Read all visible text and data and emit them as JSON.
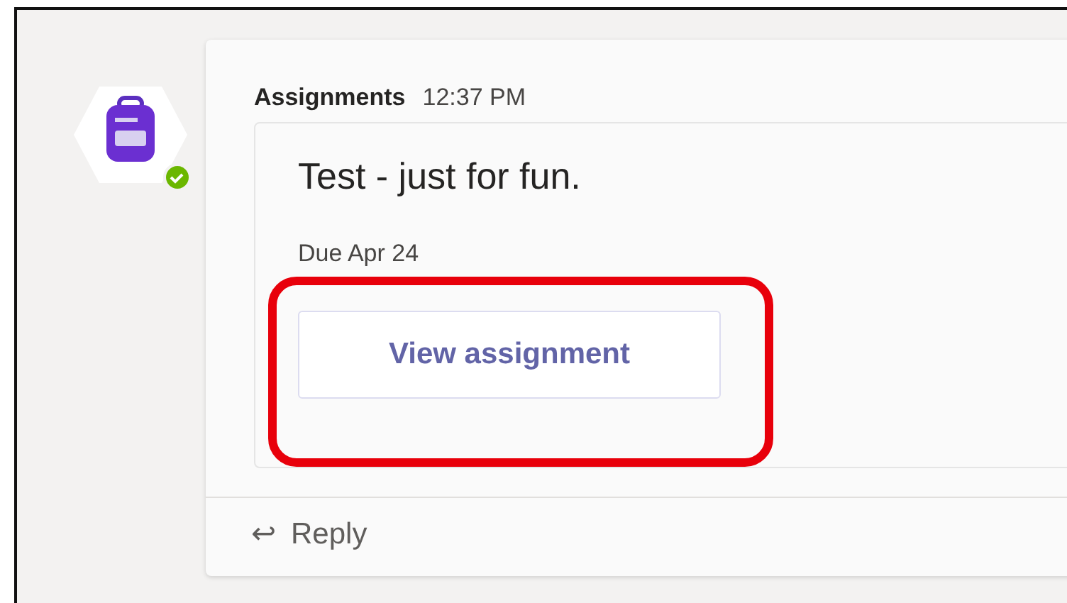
{
  "message": {
    "sender": "Assignments",
    "time": "12:37 PM",
    "online": true
  },
  "card": {
    "title": "Test - just for fun.",
    "due": "Due Apr 24",
    "button": "View assignment",
    "highlighted": true
  },
  "reply": {
    "icon": "↩",
    "label": "Reply"
  }
}
